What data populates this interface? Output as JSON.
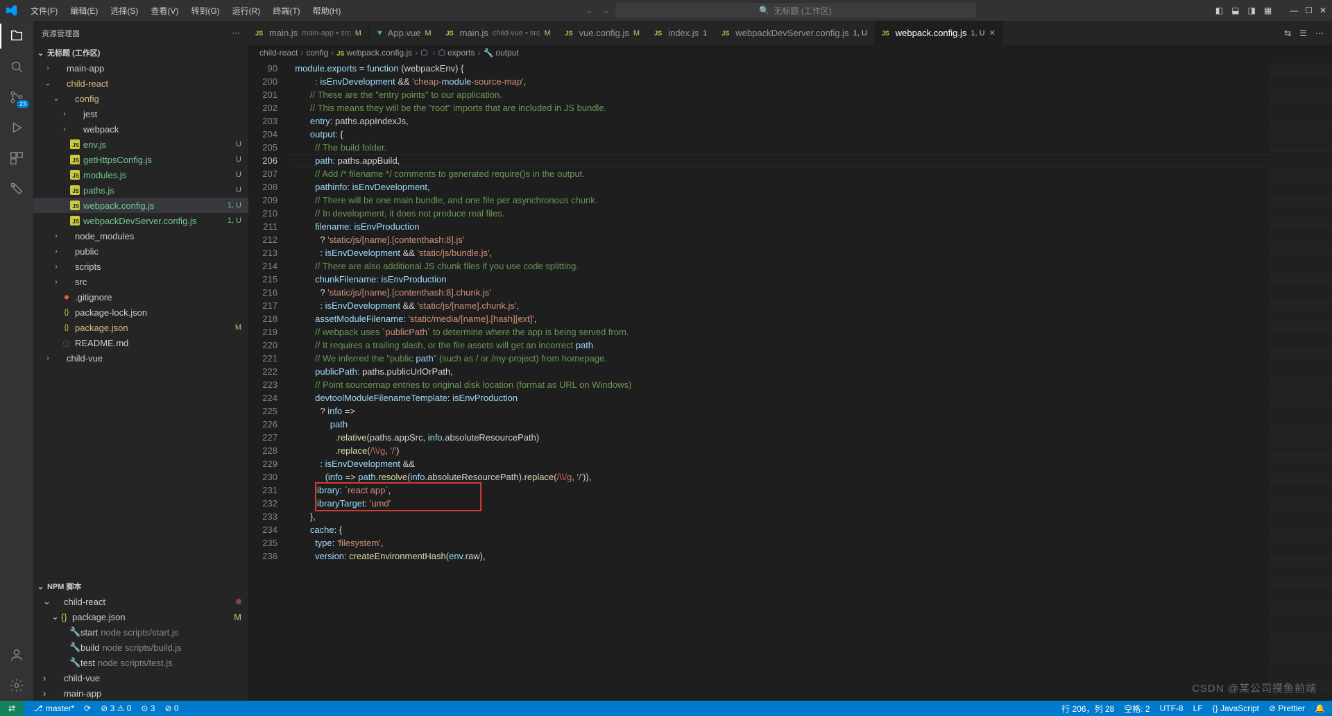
{
  "titlebar": {
    "menu": [
      "文件(F)",
      "编辑(E)",
      "选择(S)",
      "查看(V)",
      "转到(G)",
      "运行(R)",
      "终端(T)",
      "帮助(H)"
    ],
    "search_placeholder": "无标题 (工作区)",
    "search_icon": "🔍"
  },
  "activitybar": {
    "badge_scm": "23"
  },
  "sidebar": {
    "title": "资源管理器",
    "workspace": "无标题 (工作区)",
    "tree": [
      {
        "depth": 0,
        "chev": "closed",
        "type": "folder",
        "label": "main-app",
        "cls": "folder"
      },
      {
        "depth": 0,
        "chev": "open",
        "type": "folder",
        "label": "child-react",
        "cls": "modified"
      },
      {
        "depth": 1,
        "chev": "open",
        "type": "folder",
        "label": "config",
        "cls": "modified"
      },
      {
        "depth": 2,
        "chev": "closed",
        "type": "folder",
        "label": "jest",
        "cls": "folder"
      },
      {
        "depth": 2,
        "chev": "closed",
        "type": "folder",
        "label": "webpack",
        "cls": "folder"
      },
      {
        "depth": 2,
        "chev": "",
        "type": "js",
        "label": "env.js",
        "status": "U",
        "cls": "untracked"
      },
      {
        "depth": 2,
        "chev": "",
        "type": "js",
        "label": "getHttpsConfig.js",
        "status": "U",
        "cls": "untracked"
      },
      {
        "depth": 2,
        "chev": "",
        "type": "js",
        "label": "modules.js",
        "status": "U",
        "cls": "untracked"
      },
      {
        "depth": 2,
        "chev": "",
        "type": "js",
        "label": "paths.js",
        "status": "U",
        "cls": "untracked"
      },
      {
        "depth": 2,
        "chev": "",
        "type": "js",
        "label": "webpack.config.js",
        "status": "1, U",
        "cls": "untracked active"
      },
      {
        "depth": 2,
        "chev": "",
        "type": "js",
        "label": "webpackDevServer.config.js",
        "status": "1, U",
        "cls": "untracked"
      },
      {
        "depth": 1,
        "chev": "closed",
        "type": "folder",
        "label": "node_modules",
        "cls": "folder"
      },
      {
        "depth": 1,
        "chev": "closed",
        "type": "folder",
        "label": "public",
        "cls": "folder"
      },
      {
        "depth": 1,
        "chev": "closed",
        "type": "folder",
        "label": "scripts",
        "cls": "folder"
      },
      {
        "depth": 1,
        "chev": "closed",
        "type": "folder",
        "label": "src",
        "cls": "folder"
      },
      {
        "depth": 1,
        "chev": "",
        "type": "git",
        "label": ".gitignore",
        "cls": ""
      },
      {
        "depth": 1,
        "chev": "",
        "type": "json",
        "label": "package-lock.json",
        "cls": ""
      },
      {
        "depth": 1,
        "chev": "",
        "type": "json",
        "label": "package.json",
        "status": "M",
        "cls": "modified"
      },
      {
        "depth": 1,
        "chev": "",
        "type": "md",
        "label": "README.md",
        "cls": ""
      },
      {
        "depth": 0,
        "chev": "closed",
        "type": "folder",
        "label": "child-vue",
        "cls": "folder"
      }
    ],
    "npm_title": "NPM 脚本",
    "npm": [
      {
        "depth": 0,
        "chev": "open",
        "label": "child-react",
        "dot": true
      },
      {
        "depth": 1,
        "chev": "open",
        "label": "package.json",
        "status": "M",
        "cls": "modified",
        "type": "json"
      },
      {
        "depth": 2,
        "label": "start",
        "sub": "node scripts/start.js",
        "type": "script"
      },
      {
        "depth": 2,
        "label": "build",
        "sub": "node scripts/build.js",
        "type": "script"
      },
      {
        "depth": 2,
        "label": "test",
        "sub": "node scripts/test.js",
        "type": "script"
      },
      {
        "depth": 0,
        "chev": "closed",
        "label": "child-vue"
      },
      {
        "depth": 0,
        "chev": "closed",
        "label": "main-app"
      }
    ]
  },
  "tabs": [
    {
      "icon": "js",
      "label": "main.js",
      "desc": "main-app • src",
      "mod": "M"
    },
    {
      "icon": "vue",
      "label": "App.vue",
      "mod": "M"
    },
    {
      "icon": "js",
      "label": "main.js",
      "desc": "child-vue • src",
      "mod": "M"
    },
    {
      "icon": "js",
      "label": "vue.config.js",
      "mod": "M"
    },
    {
      "icon": "js",
      "label": "index.js",
      "num": "1"
    },
    {
      "icon": "js",
      "label": "webpackDevServer.config.js",
      "num": "1, U"
    },
    {
      "icon": "js",
      "label": "webpack.config.js",
      "num": "1, U",
      "active": true,
      "close": true
    }
  ],
  "breadcrumb": [
    "child-react",
    "config",
    "webpack.config.js",
    "<unknown>",
    "exports",
    "output"
  ],
  "code": {
    "first_line_no": 90,
    "first_line": "  module.exports = function (webpackEnv) {",
    "start": 200,
    "lines": [
      "          : isEnvDevelopment && 'cheap-module-source-map',",
      "        // These are the \"entry points\" to our application.",
      "        // This means they will be the \"root\" imports that are included in JS bundle.",
      "        entry: paths.appIndexJs,",
      "        output: {",
      "          // The build folder.",
      "          path: paths.appBuild,",
      "          // Add /* filename */ comments to generated require()s in the output.",
      "          pathinfo: isEnvDevelopment,",
      "          // There will be one main bundle, and one file per asynchronous chunk.",
      "          // In development, it does not produce real files.",
      "          filename: isEnvProduction",
      "            ? 'static/js/[name].[contenthash:8].js'",
      "            : isEnvDevelopment && 'static/js/bundle.js',",
      "          // There are also additional JS chunk files if you use code splitting.",
      "          chunkFilename: isEnvProduction",
      "            ? 'static/js/[name].[contenthash:8].chunk.js'",
      "            : isEnvDevelopment && 'static/js/[name].chunk.js',",
      "          assetModuleFilename: 'static/media/[name].[hash][ext]',",
      "          // webpack uses `publicPath` to determine where the app is being served from.",
      "          // It requires a trailing slash, or the file assets will get an incorrect path.",
      "          // We inferred the \"public path\" (such as / or /my-project) from homepage.",
      "          publicPath: paths.publicUrlOrPath,",
      "          // Point sourcemap entries to original disk location (format as URL on Windows)",
      "          devtoolModuleFilenameTemplate: isEnvProduction",
      "            ? info =>",
      "                path",
      "                  .relative(paths.appSrc, info.absoluteResourcePath)",
      "                  .replace(/\\\\/g, '/')",
      "            : isEnvDevelopment &&",
      "              (info => path.resolve(info.absoluteResourcePath).replace(/\\\\/g, '/')),",
      "          library: `react app`,",
      "          libraryTarget: 'umd'",
      "        },",
      "        cache: {",
      "          type: 'filesystem',",
      "          version: createEnvironmentHash(env.raw),"
    ],
    "current_line": 206,
    "redbox": {
      "line_from": 231,
      "line_to": 232
    }
  },
  "statusbar": {
    "branch": "master*",
    "sync": "⟳",
    "errors": "⊘ 3 ⚠ 0",
    "ports": "⊙ 3",
    "dbg": "⊘ 0",
    "cursor": "行 206，列 28",
    "spaces": "空格: 2",
    "encoding": "UTF-8",
    "eol": "LF",
    "lang": "{} JavaScript",
    "prettier": "⊘ Prettier",
    "bell": "🔔"
  },
  "watermark": "CSDN @某公司摸鱼前端"
}
